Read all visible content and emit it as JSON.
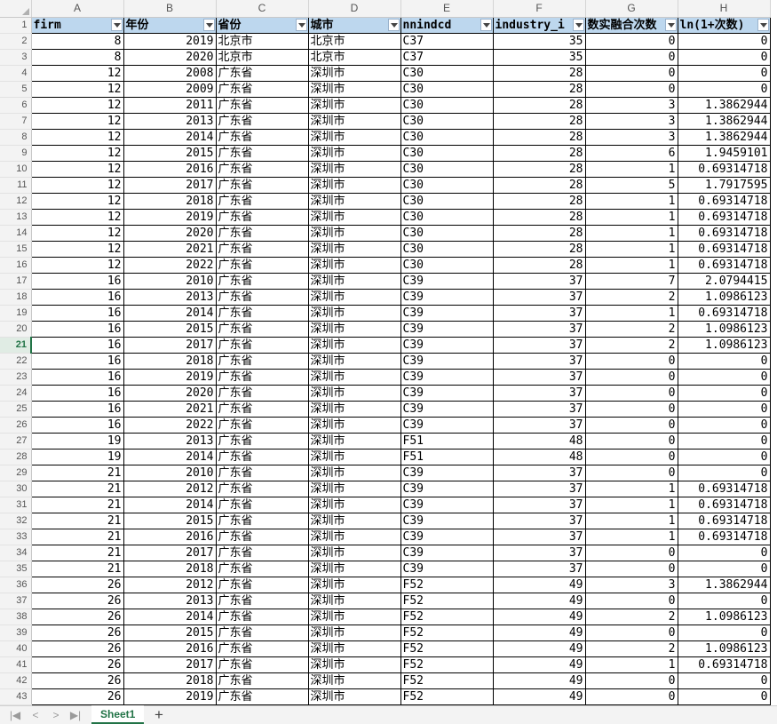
{
  "sheet": {
    "column_letters": [
      "A",
      "B",
      "C",
      "D",
      "E",
      "F",
      "G",
      "H"
    ],
    "headers": [
      "firm",
      "年份",
      "省份",
      "城市",
      "nnindcd",
      "industry_i",
      "数实融合次数",
      "ln(1+次数)"
    ],
    "active_row": 21,
    "rows": [
      [
        "8",
        "2019",
        "北京市",
        "北京市",
        "C37",
        "35",
        "0",
        "0"
      ],
      [
        "8",
        "2020",
        "北京市",
        "北京市",
        "C37",
        "35",
        "0",
        "0"
      ],
      [
        "12",
        "2008",
        "广东省",
        "深圳市",
        "C30",
        "28",
        "0",
        "0"
      ],
      [
        "12",
        "2009",
        "广东省",
        "深圳市",
        "C30",
        "28",
        "0",
        "0"
      ],
      [
        "12",
        "2011",
        "广东省",
        "深圳市",
        "C30",
        "28",
        "3",
        "1.3862944"
      ],
      [
        "12",
        "2013",
        "广东省",
        "深圳市",
        "C30",
        "28",
        "3",
        "1.3862944"
      ],
      [
        "12",
        "2014",
        "广东省",
        "深圳市",
        "C30",
        "28",
        "3",
        "1.3862944"
      ],
      [
        "12",
        "2015",
        "广东省",
        "深圳市",
        "C30",
        "28",
        "6",
        "1.9459101"
      ],
      [
        "12",
        "2016",
        "广东省",
        "深圳市",
        "C30",
        "28",
        "1",
        "0.69314718"
      ],
      [
        "12",
        "2017",
        "广东省",
        "深圳市",
        "C30",
        "28",
        "5",
        "1.7917595"
      ],
      [
        "12",
        "2018",
        "广东省",
        "深圳市",
        "C30",
        "28",
        "1",
        "0.69314718"
      ],
      [
        "12",
        "2019",
        "广东省",
        "深圳市",
        "C30",
        "28",
        "1",
        "0.69314718"
      ],
      [
        "12",
        "2020",
        "广东省",
        "深圳市",
        "C30",
        "28",
        "1",
        "0.69314718"
      ],
      [
        "12",
        "2021",
        "广东省",
        "深圳市",
        "C30",
        "28",
        "1",
        "0.69314718"
      ],
      [
        "12",
        "2022",
        "广东省",
        "深圳市",
        "C30",
        "28",
        "1",
        "0.69314718"
      ],
      [
        "16",
        "2010",
        "广东省",
        "深圳市",
        "C39",
        "37",
        "7",
        "2.0794415"
      ],
      [
        "16",
        "2013",
        "广东省",
        "深圳市",
        "C39",
        "37",
        "2",
        "1.0986123"
      ],
      [
        "16",
        "2014",
        "广东省",
        "深圳市",
        "C39",
        "37",
        "1",
        "0.69314718"
      ],
      [
        "16",
        "2015",
        "广东省",
        "深圳市",
        "C39",
        "37",
        "2",
        "1.0986123"
      ],
      [
        "16",
        "2017",
        "广东省",
        "深圳市",
        "C39",
        "37",
        "2",
        "1.0986123"
      ],
      [
        "16",
        "2018",
        "广东省",
        "深圳市",
        "C39",
        "37",
        "0",
        "0"
      ],
      [
        "16",
        "2019",
        "广东省",
        "深圳市",
        "C39",
        "37",
        "0",
        "0"
      ],
      [
        "16",
        "2020",
        "广东省",
        "深圳市",
        "C39",
        "37",
        "0",
        "0"
      ],
      [
        "16",
        "2021",
        "广东省",
        "深圳市",
        "C39",
        "37",
        "0",
        "0"
      ],
      [
        "16",
        "2022",
        "广东省",
        "深圳市",
        "C39",
        "37",
        "0",
        "0"
      ],
      [
        "19",
        "2013",
        "广东省",
        "深圳市",
        "F51",
        "48",
        "0",
        "0"
      ],
      [
        "19",
        "2014",
        "广东省",
        "深圳市",
        "F51",
        "48",
        "0",
        "0"
      ],
      [
        "21",
        "2010",
        "广东省",
        "深圳市",
        "C39",
        "37",
        "0",
        "0"
      ],
      [
        "21",
        "2012",
        "广东省",
        "深圳市",
        "C39",
        "37",
        "1",
        "0.69314718"
      ],
      [
        "21",
        "2014",
        "广东省",
        "深圳市",
        "C39",
        "37",
        "1",
        "0.69314718"
      ],
      [
        "21",
        "2015",
        "广东省",
        "深圳市",
        "C39",
        "37",
        "1",
        "0.69314718"
      ],
      [
        "21",
        "2016",
        "广东省",
        "深圳市",
        "C39",
        "37",
        "1",
        "0.69314718"
      ],
      [
        "21",
        "2017",
        "广东省",
        "深圳市",
        "C39",
        "37",
        "0",
        "0"
      ],
      [
        "21",
        "2018",
        "广东省",
        "深圳市",
        "C39",
        "37",
        "0",
        "0"
      ],
      [
        "26",
        "2012",
        "广东省",
        "深圳市",
        "F52",
        "49",
        "3",
        "1.3862944"
      ],
      [
        "26",
        "2013",
        "广东省",
        "深圳市",
        "F52",
        "49",
        "0",
        "0"
      ],
      [
        "26",
        "2014",
        "广东省",
        "深圳市",
        "F52",
        "49",
        "2",
        "1.0986123"
      ],
      [
        "26",
        "2015",
        "广东省",
        "深圳市",
        "F52",
        "49",
        "0",
        "0"
      ],
      [
        "26",
        "2016",
        "广东省",
        "深圳市",
        "F52",
        "49",
        "2",
        "1.0986123"
      ],
      [
        "26",
        "2017",
        "广东省",
        "深圳市",
        "F52",
        "49",
        "1",
        "0.69314718"
      ],
      [
        "26",
        "2018",
        "广东省",
        "深圳市",
        "F52",
        "49",
        "0",
        "0"
      ],
      [
        "26",
        "2019",
        "广东省",
        "深圳市",
        "F52",
        "49",
        "0",
        "0"
      ]
    ]
  },
  "tabs": {
    "first_icon": "first-sheet-icon",
    "prev_icon": "prev-sheet-icon",
    "next_icon": "next-sheet-icon",
    "last_icon": "last-sheet-icon",
    "sheet_name": "Sheet1",
    "add_label": "+"
  },
  "colors": {
    "header_fill": "#bdd7ee",
    "accent": "#217346"
  }
}
